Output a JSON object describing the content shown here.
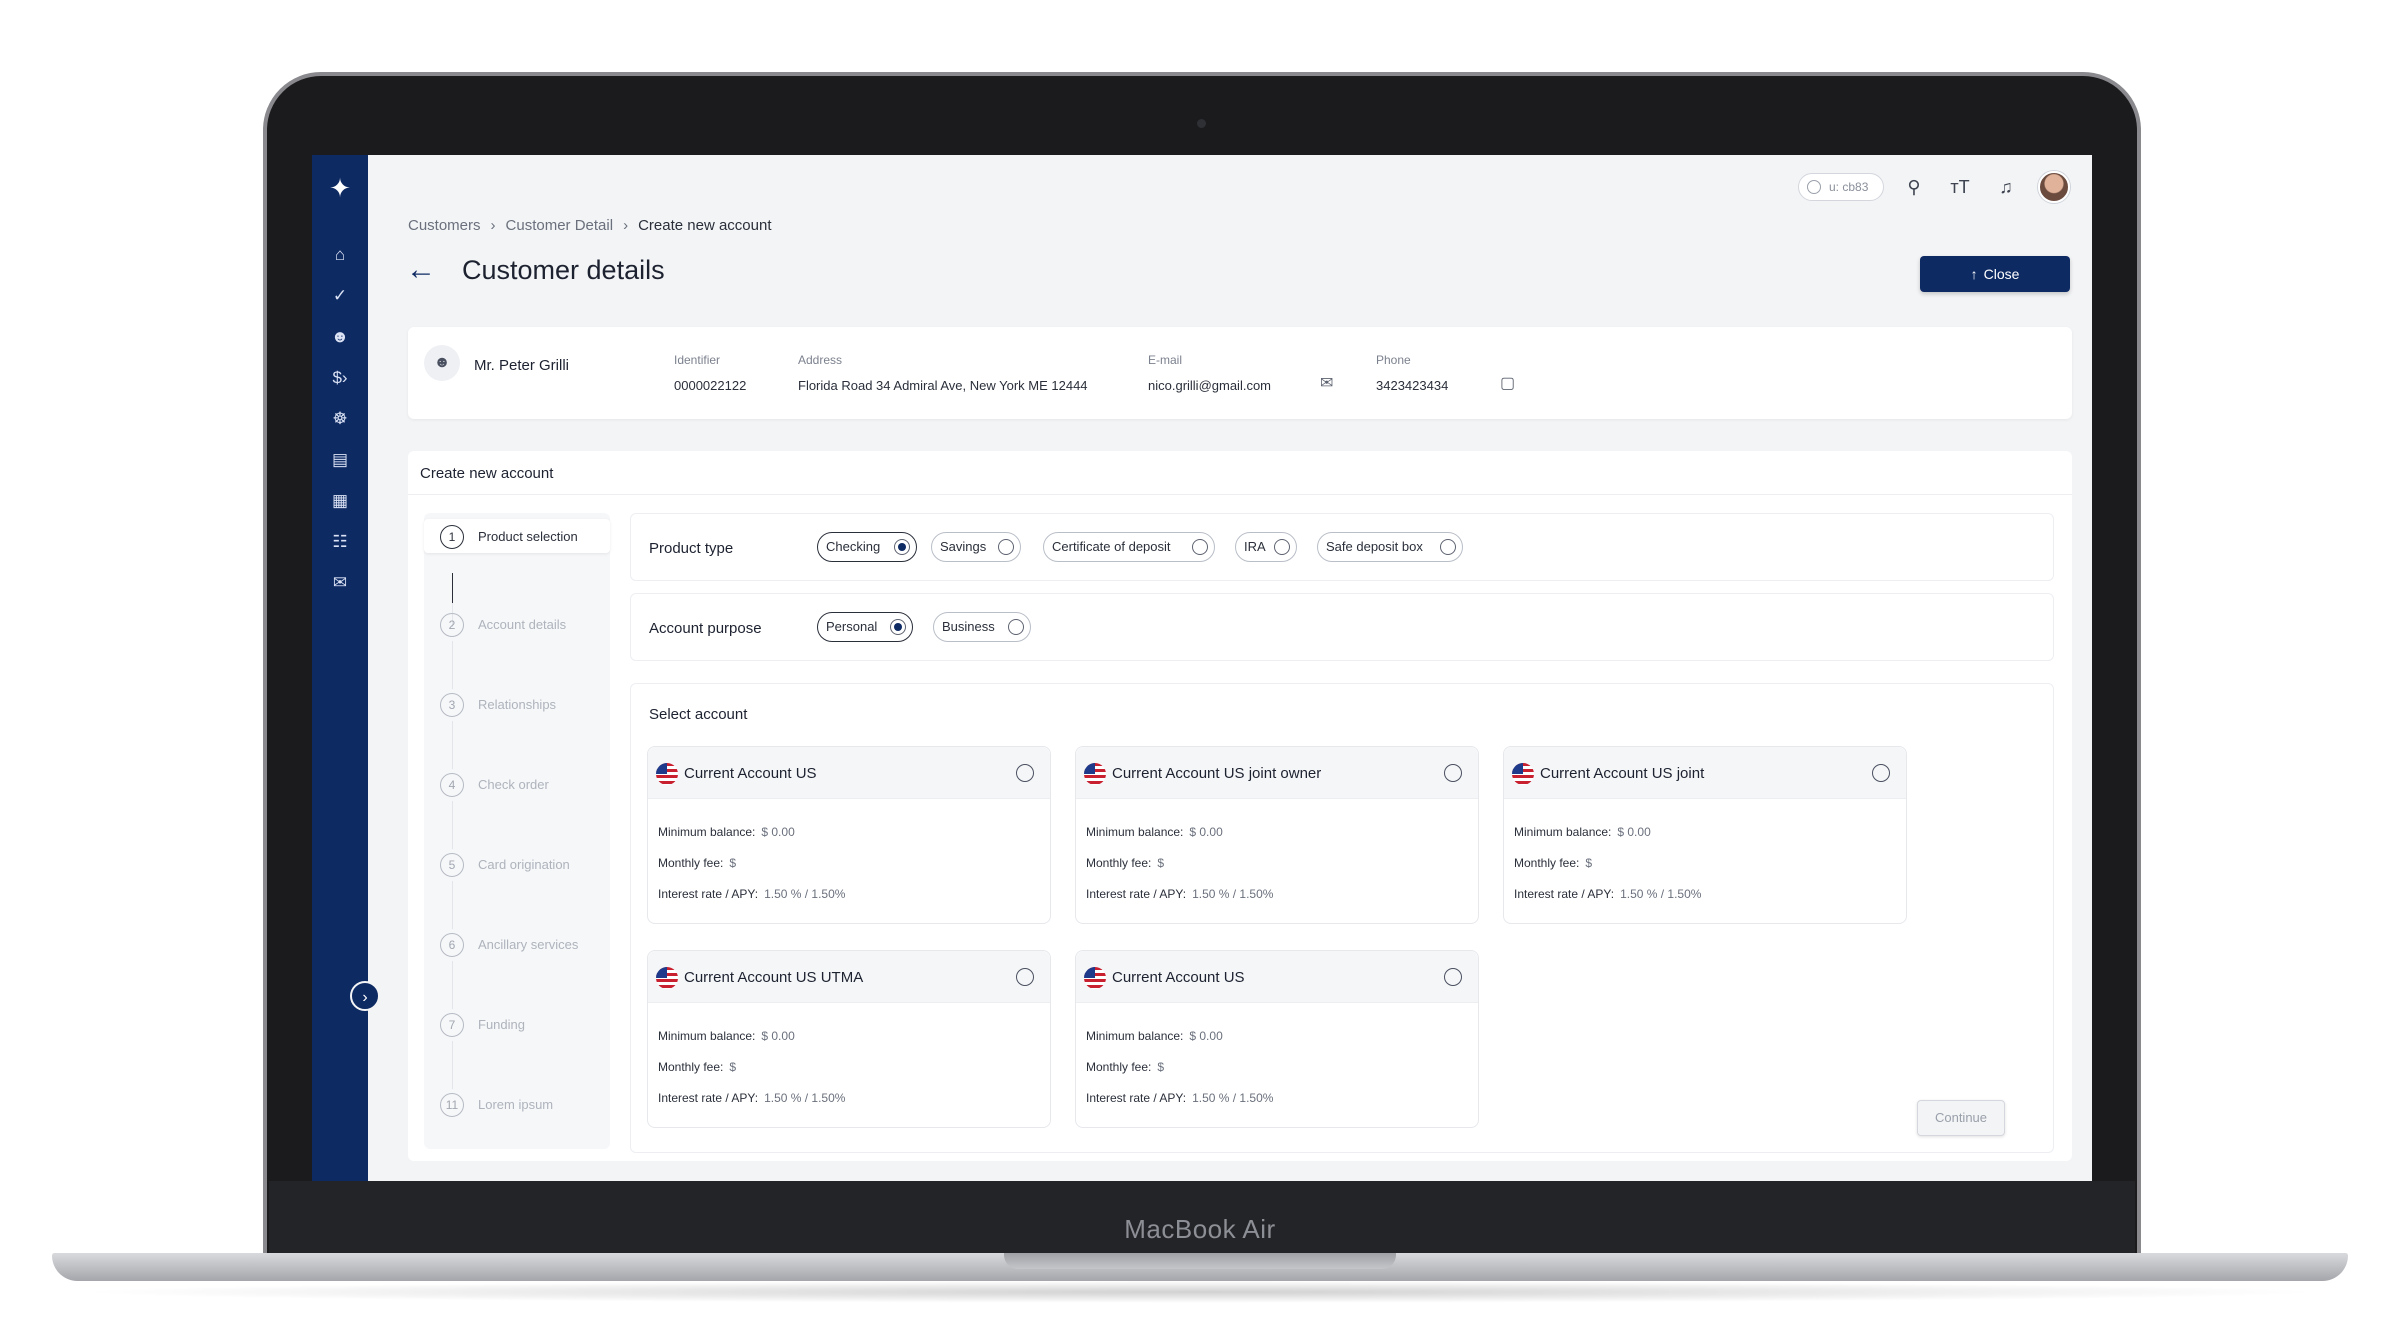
{
  "device": {
    "brand": "MacBook Air"
  },
  "topbar": {
    "user_label": "u: cb83"
  },
  "breadcrumb": [
    "Customers",
    "Customer Detail",
    "Create new account"
  ],
  "header": {
    "title": "Customer details",
    "close_label": "Close"
  },
  "customer": {
    "name": "Mr. Peter Grilli",
    "identifier_label": "Identifier",
    "identifier": "0000022122",
    "address_label": "Address",
    "address": "Florida Road 34 Admiral Ave, New York ME 12444",
    "email_label": "E-mail",
    "email": "nico.grilli@gmail.com",
    "phone_label": "Phone",
    "phone": "3423423434"
  },
  "panel": {
    "title": "Create new account"
  },
  "steps": [
    {
      "num": "1",
      "label": "Product selection"
    },
    {
      "num": "2",
      "label": "Account details"
    },
    {
      "num": "3",
      "label": "Relationships"
    },
    {
      "num": "4",
      "label": "Check order"
    },
    {
      "num": "5",
      "label": "Card origination"
    },
    {
      "num": "6",
      "label": "Ancillary services"
    },
    {
      "num": "7",
      "label": "Funding"
    },
    {
      "num": "11",
      "label": "Lorem ipsum"
    }
  ],
  "product_type": {
    "label": "Product type",
    "options": [
      "Checking",
      "Savings",
      "Certificate of deposit",
      "IRA",
      "Safe deposit box"
    ],
    "selected": "Checking"
  },
  "account_purpose": {
    "label": "Account purpose",
    "options": [
      "Personal",
      "Business"
    ],
    "selected": "Personal"
  },
  "select_account": {
    "title": "Select account",
    "labels": {
      "min": "Minimum balance:",
      "fee": "Monthly fee:",
      "rate": "Interest rate / APY:"
    },
    "accounts": [
      {
        "name": "Current Account US",
        "min": "$ 0.00",
        "fee": "$",
        "rate": "1.50 % / 1.50%"
      },
      {
        "name": "Current Account US joint owner",
        "min": "$ 0.00",
        "fee": "$",
        "rate": "1.50 % / 1.50%"
      },
      {
        "name": "Current Account US joint",
        "min": "$ 0.00",
        "fee": "$",
        "rate": "1.50 % / 1.50%"
      },
      {
        "name": "Current Account US UTMA",
        "min": "$ 0.00",
        "fee": "$",
        "rate": "1.50 % / 1.50%"
      },
      {
        "name": "Current Account US",
        "min": "$ 0.00",
        "fee": "$",
        "rate": "1.50 % / 1.50%"
      }
    ],
    "continue_label": "Continue"
  },
  "icons": {
    "sidebar": [
      "globe-logo-icon",
      "home-icon",
      "check-icon",
      "person-icon",
      "dollar-icon",
      "group-icon",
      "card-icon",
      "grid-icon",
      "docs-icon",
      "chat-icon"
    ],
    "topbar": [
      "search-icon",
      "text-size-icon",
      "bell-icon"
    ]
  },
  "colors": {
    "brand": "#0e2a63",
    "background": "#f3f4f6"
  }
}
